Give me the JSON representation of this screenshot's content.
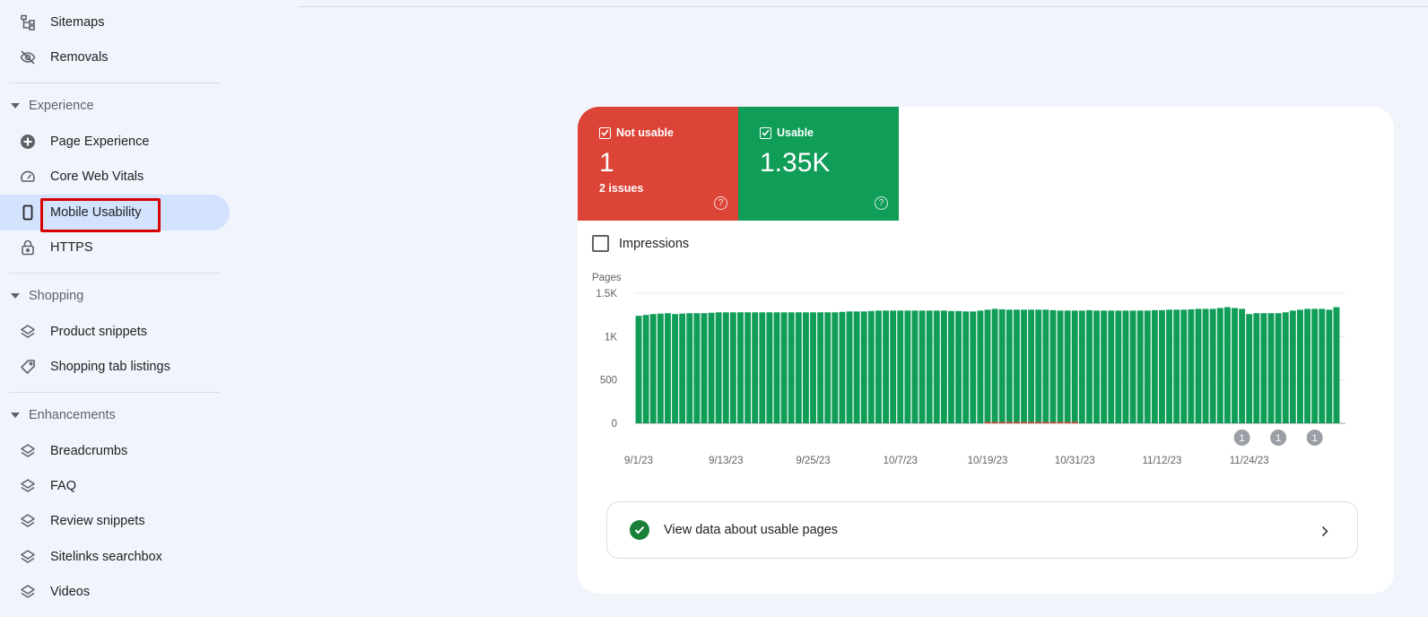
{
  "sidebar": {
    "top_items": [
      {
        "label": "Sitemaps",
        "icon": "sitemap-icon"
      },
      {
        "label": "Removals",
        "icon": "eye-off-icon"
      }
    ],
    "experience": {
      "header": "Experience",
      "items": [
        {
          "label": "Page Experience",
          "icon": "plus-circle-icon"
        },
        {
          "label": "Core Web Vitals",
          "icon": "speedometer-icon"
        },
        {
          "label": "Mobile Usability",
          "icon": "phone-icon",
          "active": true
        },
        {
          "label": "HTTPS",
          "icon": "lock-icon"
        }
      ]
    },
    "shopping": {
      "header": "Shopping",
      "items": [
        {
          "label": "Product snippets",
          "icon": "layers-icon"
        },
        {
          "label": "Shopping tab listings",
          "icon": "tag-icon"
        }
      ]
    },
    "enhancements": {
      "header": "Enhancements",
      "items": [
        {
          "label": "Breadcrumbs",
          "icon": "layers-icon"
        },
        {
          "label": "FAQ",
          "icon": "layers-icon"
        },
        {
          "label": "Review snippets",
          "icon": "layers-icon"
        },
        {
          "label": "Sitelinks searchbox",
          "icon": "layers-icon"
        },
        {
          "label": "Videos",
          "icon": "layers-icon"
        }
      ]
    }
  },
  "summary": {
    "not_usable": {
      "label": "Not usable",
      "value": "1",
      "sub": "2 issues",
      "color": "#db4437"
    },
    "usable": {
      "label": "Usable",
      "value": "1.35K",
      "color": "#0f9d58"
    }
  },
  "impressions_label": "Impressions",
  "view_link_label": "View data about usable pages",
  "chart_data": {
    "type": "bar",
    "ylabel": "Pages",
    "ylim": [
      0,
      1500
    ],
    "yticks": [
      "0",
      "500",
      "1K",
      "1.5K"
    ],
    "ytick_values": [
      0,
      500,
      1000,
      1500
    ],
    "xtick_labels": [
      "9/1/23",
      "9/13/23",
      "9/25/23",
      "10/7/23",
      "10/19/23",
      "10/31/23",
      "11/12/23",
      "11/24/23"
    ],
    "xtick_index": [
      0,
      12,
      24,
      36,
      48,
      60,
      72,
      84
    ],
    "series": [
      {
        "name": "Usable",
        "color": "#0f9d58",
        "values": [
          1240,
          1250,
          1260,
          1265,
          1270,
          1260,
          1265,
          1270,
          1270,
          1270,
          1275,
          1280,
          1280,
          1280,
          1280,
          1280,
          1280,
          1280,
          1280,
          1280,
          1280,
          1280,
          1280,
          1280,
          1280,
          1280,
          1280,
          1280,
          1285,
          1290,
          1290,
          1290,
          1295,
          1300,
          1300,
          1300,
          1300,
          1300,
          1300,
          1300,
          1300,
          1300,
          1300,
          1295,
          1295,
          1290,
          1290,
          1300,
          1310,
          1320,
          1315,
          1310,
          1310,
          1310,
          1310,
          1310,
          1310,
          1305,
          1300,
          1300,
          1300,
          1300,
          1305,
          1300,
          1300,
          1300,
          1300,
          1300,
          1300,
          1300,
          1300,
          1305,
          1305,
          1310,
          1310,
          1310,
          1315,
          1320,
          1320,
          1320,
          1330,
          1340,
          1330,
          1320,
          1260,
          1270,
          1270,
          1270,
          1270,
          1280,
          1300,
          1310,
          1320,
          1320,
          1320,
          1310,
          1340
        ]
      },
      {
        "name": "Not usable",
        "color": "#db4437",
        "values": [
          0,
          0,
          0,
          0,
          0,
          0,
          0,
          0,
          0,
          0,
          0,
          0,
          0,
          0,
          0,
          0,
          0,
          0,
          0,
          0,
          0,
          0,
          0,
          0,
          0,
          0,
          0,
          0,
          0,
          0,
          0,
          0,
          0,
          0,
          0,
          0,
          0,
          0,
          0,
          0,
          0,
          0,
          0,
          0,
          0,
          0,
          0,
          0,
          14,
          14,
          14,
          14,
          14,
          14,
          14,
          14,
          14,
          14,
          14,
          14,
          14,
          0,
          0,
          0,
          0,
          0,
          0,
          0,
          0,
          0,
          0,
          0,
          0,
          0,
          0,
          0,
          0,
          0,
          0,
          0,
          0,
          0,
          0,
          0,
          0,
          0,
          0,
          0,
          0,
          0,
          0,
          0,
          0,
          0,
          0,
          0,
          0
        ]
      }
    ],
    "annotations": [
      {
        "index": 83,
        "label": "1"
      },
      {
        "index": 88,
        "label": "1"
      },
      {
        "index": 93,
        "label": "1"
      }
    ]
  }
}
